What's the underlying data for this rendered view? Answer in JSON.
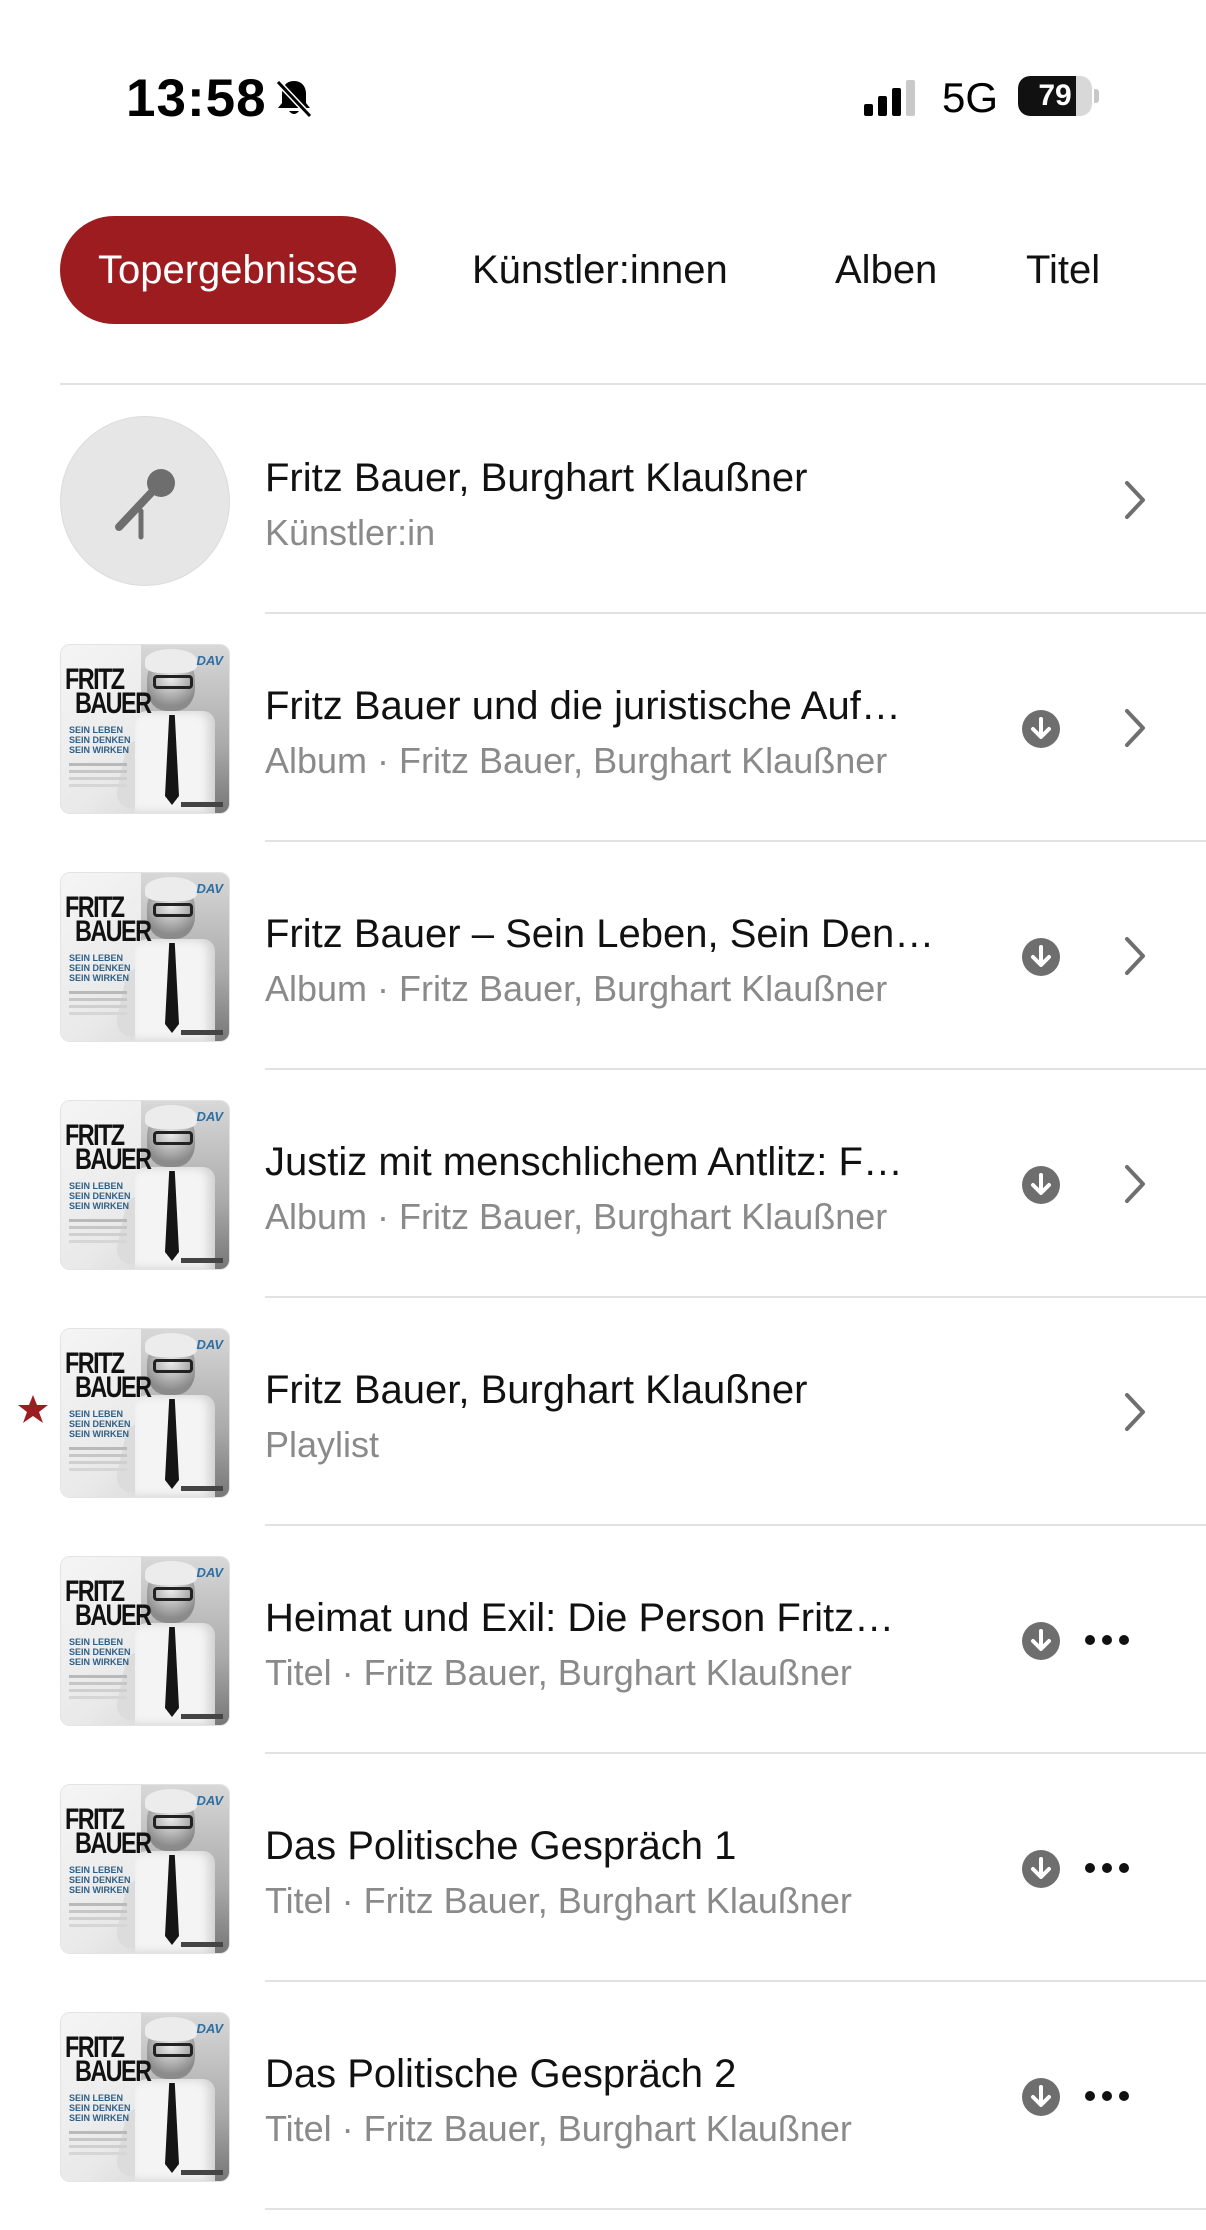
{
  "status_bar": {
    "time": "13:58",
    "network": "5G",
    "battery": "79",
    "battery_level": 0.79
  },
  "tabs": [
    {
      "label": "Topergebnisse",
      "active": true
    },
    {
      "label": "Künstler:innen",
      "active": false
    },
    {
      "label": "Alben",
      "active": false
    },
    {
      "label": "Titel",
      "active": false
    }
  ],
  "cover_art": {
    "line1": "FRITZ",
    "line2": "BAUER",
    "blue_text": "SEIN LEBEN SEIN DENKEN SEIN WIRKEN",
    "label": "DAV"
  },
  "results": [
    {
      "title": "Fritz Bauer, Burghart Klaußner",
      "subtitle": "Künstler:in",
      "kind": "artist",
      "action": "chevron",
      "download": false,
      "starred": false
    },
    {
      "title": "Fritz Bauer und die juristische Auf…",
      "subtitle": "Album · Fritz Bauer, Burghart Klaußner",
      "kind": "album",
      "action": "chevron",
      "download": true,
      "starred": false
    },
    {
      "title": "Fritz Bauer – Sein Leben, Sein Den…",
      "subtitle": "Album · Fritz Bauer, Burghart Klaußner",
      "kind": "album",
      "action": "chevron",
      "download": true,
      "starred": false
    },
    {
      "title": "Justiz mit menschlichem Antlitz: F…",
      "subtitle": "Album · Fritz Bauer, Burghart Klaußner",
      "kind": "album",
      "action": "chevron",
      "download": true,
      "starred": false
    },
    {
      "title": "Fritz Bauer, Burghart Klaußner",
      "subtitle": "Playlist",
      "kind": "playlist",
      "action": "chevron",
      "download": false,
      "starred": true
    },
    {
      "title": "Heimat und Exil: Die Person Fritz…",
      "subtitle": "Titel · Fritz Bauer, Burghart Klaußner",
      "kind": "song",
      "action": "more",
      "download": true,
      "starred": false
    },
    {
      "title": "Das Politische Gespräch 1",
      "subtitle": "Titel · Fritz Bauer, Burghart Klaußner",
      "kind": "song",
      "action": "more",
      "download": true,
      "starred": false
    },
    {
      "title": "Das Politische Gespräch 2",
      "subtitle": "Titel · Fritz Bauer, Burghart Klaußner",
      "kind": "song",
      "action": "more",
      "download": true,
      "starred": false
    }
  ],
  "colors": {
    "accent": "#9d1c1f",
    "secondary_text": "#8a8a8a",
    "icon_gray": "#6e6e6e"
  }
}
